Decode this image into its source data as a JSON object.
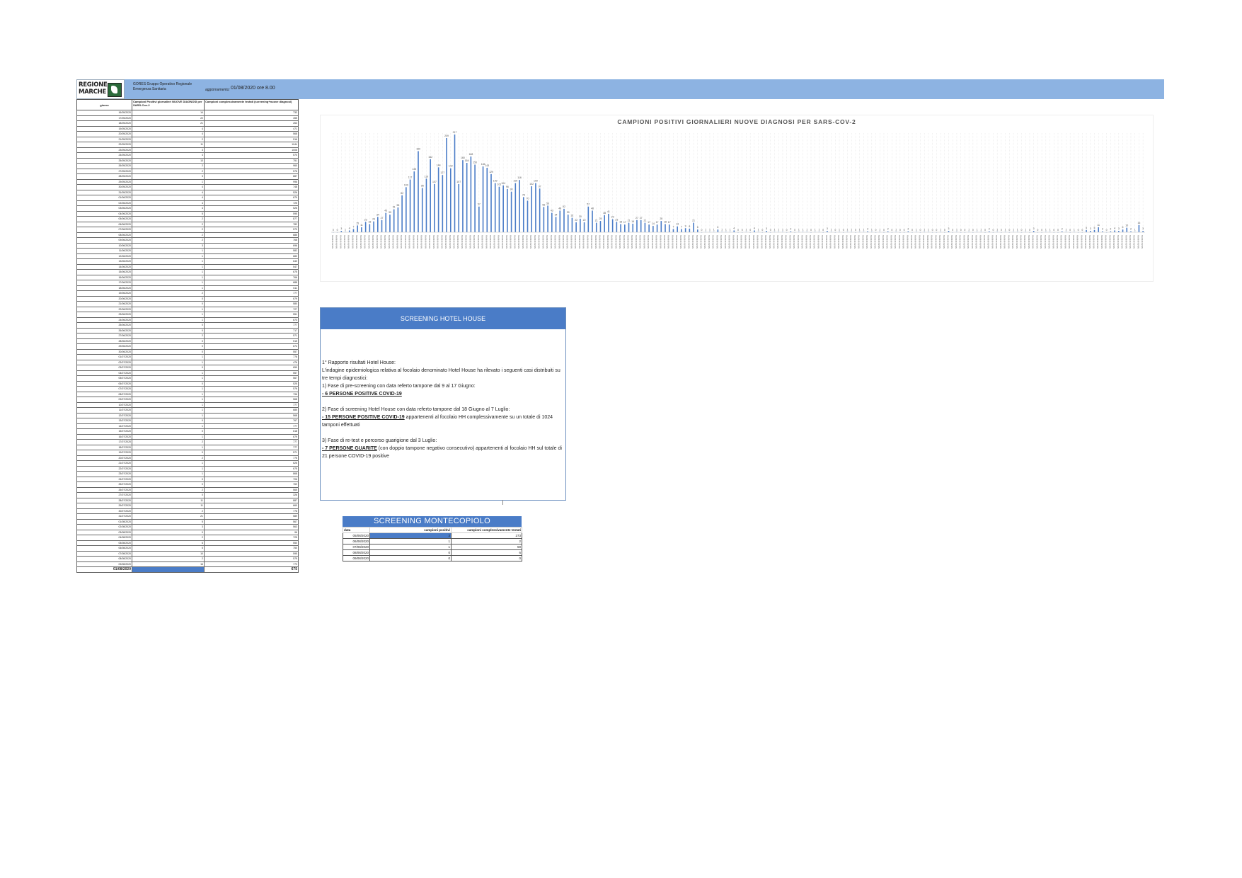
{
  "header": {
    "logo_text": "REGIONE MARCHE",
    "org": "GORES Gruppo Operativo Regionale Emergenza Sanitaria",
    "update_label": "aggiornamento:",
    "update_value": "01/08/2020 ore 8.00"
  },
  "left_table": {
    "columns": [
      "giorno",
      "Campioni Positivi giornalieri NUOVE DIAGNOSI per SARS-Cov-2",
      "Campioni complessivamente testati (screening+nuove diagnosi)"
    ],
    "rows": [
      [
        "16/05/2020",
        "14",
        "733"
      ],
      [
        "17/05/2020",
        "22",
        "455"
      ],
      [
        "18/05/2020",
        "21",
        "263"
      ],
      [
        "19/05/2020",
        "4",
        "471"
      ],
      [
        "20/05/2020",
        "4",
        "568"
      ],
      [
        "21/05/2020",
        "2",
        "516"
      ],
      [
        "22/05/2020",
        "11",
        "1044"
      ],
      [
        "23/05/2020",
        "3",
        "1006"
      ],
      [
        "24/05/2020",
        "4",
        "570"
      ],
      [
        "25/05/2020",
        "13",
        "751"
      ],
      [
        "26/05/2020",
        "2",
        "960"
      ],
      [
        "27/05/2020",
        "2",
        "576"
      ],
      [
        "28/05/2020",
        "3",
        "887"
      ],
      [
        "29/05/2020",
        "1",
        "996"
      ],
      [
        "30/05/2020",
        "4",
        "748"
      ],
      [
        "31/05/2020",
        "4",
        "526"
      ],
      [
        "01/06/2020",
        "4",
        "679"
      ],
      [
        "02/06/2020",
        "4",
        "725"
      ],
      [
        "03/06/2020",
        "4",
        "526"
      ],
      [
        "04/06/2020",
        "5",
        "595"
      ],
      [
        "05/06/2020",
        "2",
        "877"
      ],
      [
        "06/06/2020",
        "2",
        "782"
      ],
      [
        "07/06/2020",
        "2",
        "570"
      ],
      [
        "08/06/2020",
        "2",
        "685"
      ],
      [
        "09/06/2020",
        "2",
        "768"
      ],
      [
        "10/06/2020",
        "3",
        "696"
      ],
      [
        "11/06/2020",
        "1",
        "582"
      ],
      [
        "12/06/2020",
        "1",
        "680"
      ],
      [
        "13/06/2020",
        "1",
        "640"
      ],
      [
        "14/06/2020",
        "1",
        "547"
      ],
      [
        "15/06/2020",
        "1",
        "675"
      ],
      [
        "16/06/2020",
        "1",
        "766"
      ],
      [
        "17/06/2020",
        "1",
        "688"
      ],
      [
        "18/06/2020",
        "1",
        "611"
      ],
      [
        "19/06/2020",
        "2",
        "777"
      ],
      [
        "20/06/2020",
        "0",
        "679"
      ],
      [
        "21/06/2020",
        "0",
        "580"
      ],
      [
        "22/06/2020",
        "1",
        "727"
      ],
      [
        "23/06/2020",
        "1",
        "551"
      ],
      [
        "24/06/2020",
        "1",
        "673"
      ],
      [
        "25/06/2020",
        "0",
        "777"
      ],
      [
        "26/06/2020",
        "0",
        "717"
      ],
      [
        "27/06/2020",
        "2",
        "571"
      ],
      [
        "28/06/2020",
        "0",
        "515"
      ],
      [
        "29/06/2020",
        "0",
        "674"
      ],
      [
        "30/06/2020",
        "0",
        "557"
      ],
      [
        "01/07/2020",
        "1",
        "776"
      ],
      [
        "02/07/2020",
        "1",
        "476"
      ],
      [
        "03/07/2020",
        "0",
        "659"
      ],
      [
        "04/07/2020",
        "1",
        "557"
      ],
      [
        "05/07/2020",
        "1",
        "567"
      ],
      [
        "06/07/2020",
        "0",
        "525"
      ],
      [
        "07/07/2020",
        "1",
        "576"
      ],
      [
        "08/07/2020",
        "1",
        "796"
      ],
      [
        "09/07/2020",
        "1",
        "568"
      ],
      [
        "10/07/2020",
        "1",
        "777"
      ],
      [
        "11/07/2020",
        "1",
        "685"
      ],
      [
        "12/07/2020",
        "1",
        "568"
      ],
      [
        "13/07/2020",
        "0",
        "767"
      ],
      [
        "14/07/2020",
        "1",
        "777"
      ],
      [
        "15/07/2020",
        "0",
        "618"
      ],
      [
        "16/07/2020",
        "1",
        "679"
      ],
      [
        "17/07/2020",
        "2",
        "777"
      ],
      [
        "18/07/2020",
        "1",
        "777"
      ],
      [
        "19/07/2020",
        "0",
        "571"
      ],
      [
        "20/07/2020",
        "2",
        "775"
      ],
      [
        "21/07/2020",
        "1",
        "626"
      ],
      [
        "22/07/2020",
        "1",
        "675"
      ],
      [
        "23/07/2020",
        "1",
        "868"
      ],
      [
        "24/07/2020",
        "0",
        "706"
      ],
      [
        "25/07/2020",
        "0",
        "769"
      ],
      [
        "26/07/2020",
        "2",
        "565"
      ],
      [
        "27/07/2020",
        "0",
        "326"
      ],
      [
        "28/07/2020",
        "11",
        "887"
      ],
      [
        "29/07/2020",
        "11",
        "660"
      ],
      [
        "30/07/2020",
        "2",
        "776"
      ],
      [
        "31/07/2020",
        "21",
        "589"
      ],
      [
        "01/08/2020",
        "5",
        "567"
      ],
      [
        "02/08/2020",
        "3",
        "563"
      ],
      [
        "03/08/2020",
        "0",
        "96"
      ],
      [
        "04/08/2020",
        "2",
        "725"
      ],
      [
        "05/08/2020",
        "6",
        "550"
      ],
      [
        "06/08/2020",
        "5",
        "750"
      ],
      [
        "07/08/2020",
        "10",
        "595"
      ],
      [
        "08/08/2020",
        "2",
        "575"
      ],
      [
        "09/08/2020",
        "16",
        "773"
      ]
    ],
    "last_row": [
      "01/08/2020",
      "2",
      "675"
    ]
  },
  "chart_data": {
    "type": "bar",
    "title": "CAMPIONI POSITIVI GIORNALIERI NUOVE DIAGNOSI PER SARS-COV-2",
    "xlabel": "",
    "ylabel": "",
    "ylim": [
      0,
      220
    ],
    "grid": true,
    "label_template": "NN/NN/NNNN",
    "values": [
      0,
      0,
      3,
      1,
      4,
      7,
      15,
      11,
      23,
      18,
      24,
      34,
      27,
      43,
      39,
      51,
      55,
      82,
      100,
      117,
      135,
      180,
      98,
      119,
      162,
      107,
      144,
      127,
      209,
      142,
      217,
      107,
      160,
      154,
      168,
      150,
      57,
      146,
      143,
      129,
      109,
      101,
      104,
      96,
      90,
      109,
      116,
      78,
      70,
      102,
      109,
      97,
      56,
      59,
      43,
      34,
      48,
      52,
      39,
      32,
      22,
      30,
      22,
      57,
      48,
      21,
      25,
      38,
      41,
      29,
      23,
      18,
      17,
      21,
      19,
      27,
      27,
      21,
      17,
      14,
      17,
      25,
      18,
      17,
      7,
      13,
      7,
      9,
      8,
      21,
      6,
      0,
      1,
      1,
      1,
      6,
      1,
      1,
      1,
      4,
      0,
      0,
      1,
      0,
      4,
      1,
      0,
      3,
      0,
      1,
      1,
      1,
      0,
      2,
      0,
      1,
      1,
      1,
      0,
      1,
      1,
      0,
      3,
      1,
      0,
      1,
      0,
      1,
      1,
      0,
      1,
      1,
      2,
      1,
      0,
      1,
      0,
      2,
      0,
      1,
      0,
      0,
      2,
      0,
      1,
      0,
      1,
      1,
      0,
      0,
      1,
      0,
      3,
      0,
      1,
      0,
      0,
      1,
      0,
      1,
      1,
      0,
      2,
      0,
      1,
      0,
      1,
      0,
      1,
      1,
      0,
      1,
      0,
      3,
      0,
      0,
      1,
      1,
      0,
      0,
      2,
      1,
      0,
      1,
      0,
      0,
      5,
      3,
      5,
      11,
      2,
      0,
      2,
      4,
      3,
      6,
      10,
      2,
      1,
      16,
      3
    ]
  },
  "hotel_house": {
    "title": "SCREENING HOTEL HOUSE",
    "lines": [
      "1° Rapporto risultati Hotel House:",
      "L'indagine epidemiologica relativa al focolaio denominato Hotel House ha rilevato i seguenti casi distribuiti su tre tempi diagnostici:",
      "1) Fase di pre-screening con data referto tampone dal 9 al 17 Giugno:",
      "- 6 PERSONE POSITIVE COVID-19",
      "2) Fase di screening Hotel House con data referto tampone dal 18 Giugno al 7 Luglio:",
      "- 15 PERSONE POSITIVE COVID-19",
      " appartenenti al focolaio HH complessivamente su un totale di 1024 tamponi effettuati",
      "3) Fase di re-test e percorso guarigione dal 3 Luglio:",
      "- 7 PERSONE GUARITE",
      " (con doppio tampone negativo consecutivo) appartenenti al focolaio HH sul totale di 21 persone COVID-19 positive"
    ]
  },
  "montecopiolo": {
    "title": "SCREENING MONTECOPIOLO",
    "columns": [
      "data",
      "campioni positivi",
      "campioni complessivamente testati"
    ],
    "rows": [
      [
        "05/08/2020",
        "3",
        "273"
      ],
      [
        "06/08/2020",
        "1",
        "2"
      ],
      [
        "07/08/2020",
        "1",
        "59"
      ],
      [
        "08/08/2020",
        "0",
        "6"
      ],
      [
        "09/08/2020",
        "0",
        "0"
      ]
    ]
  }
}
